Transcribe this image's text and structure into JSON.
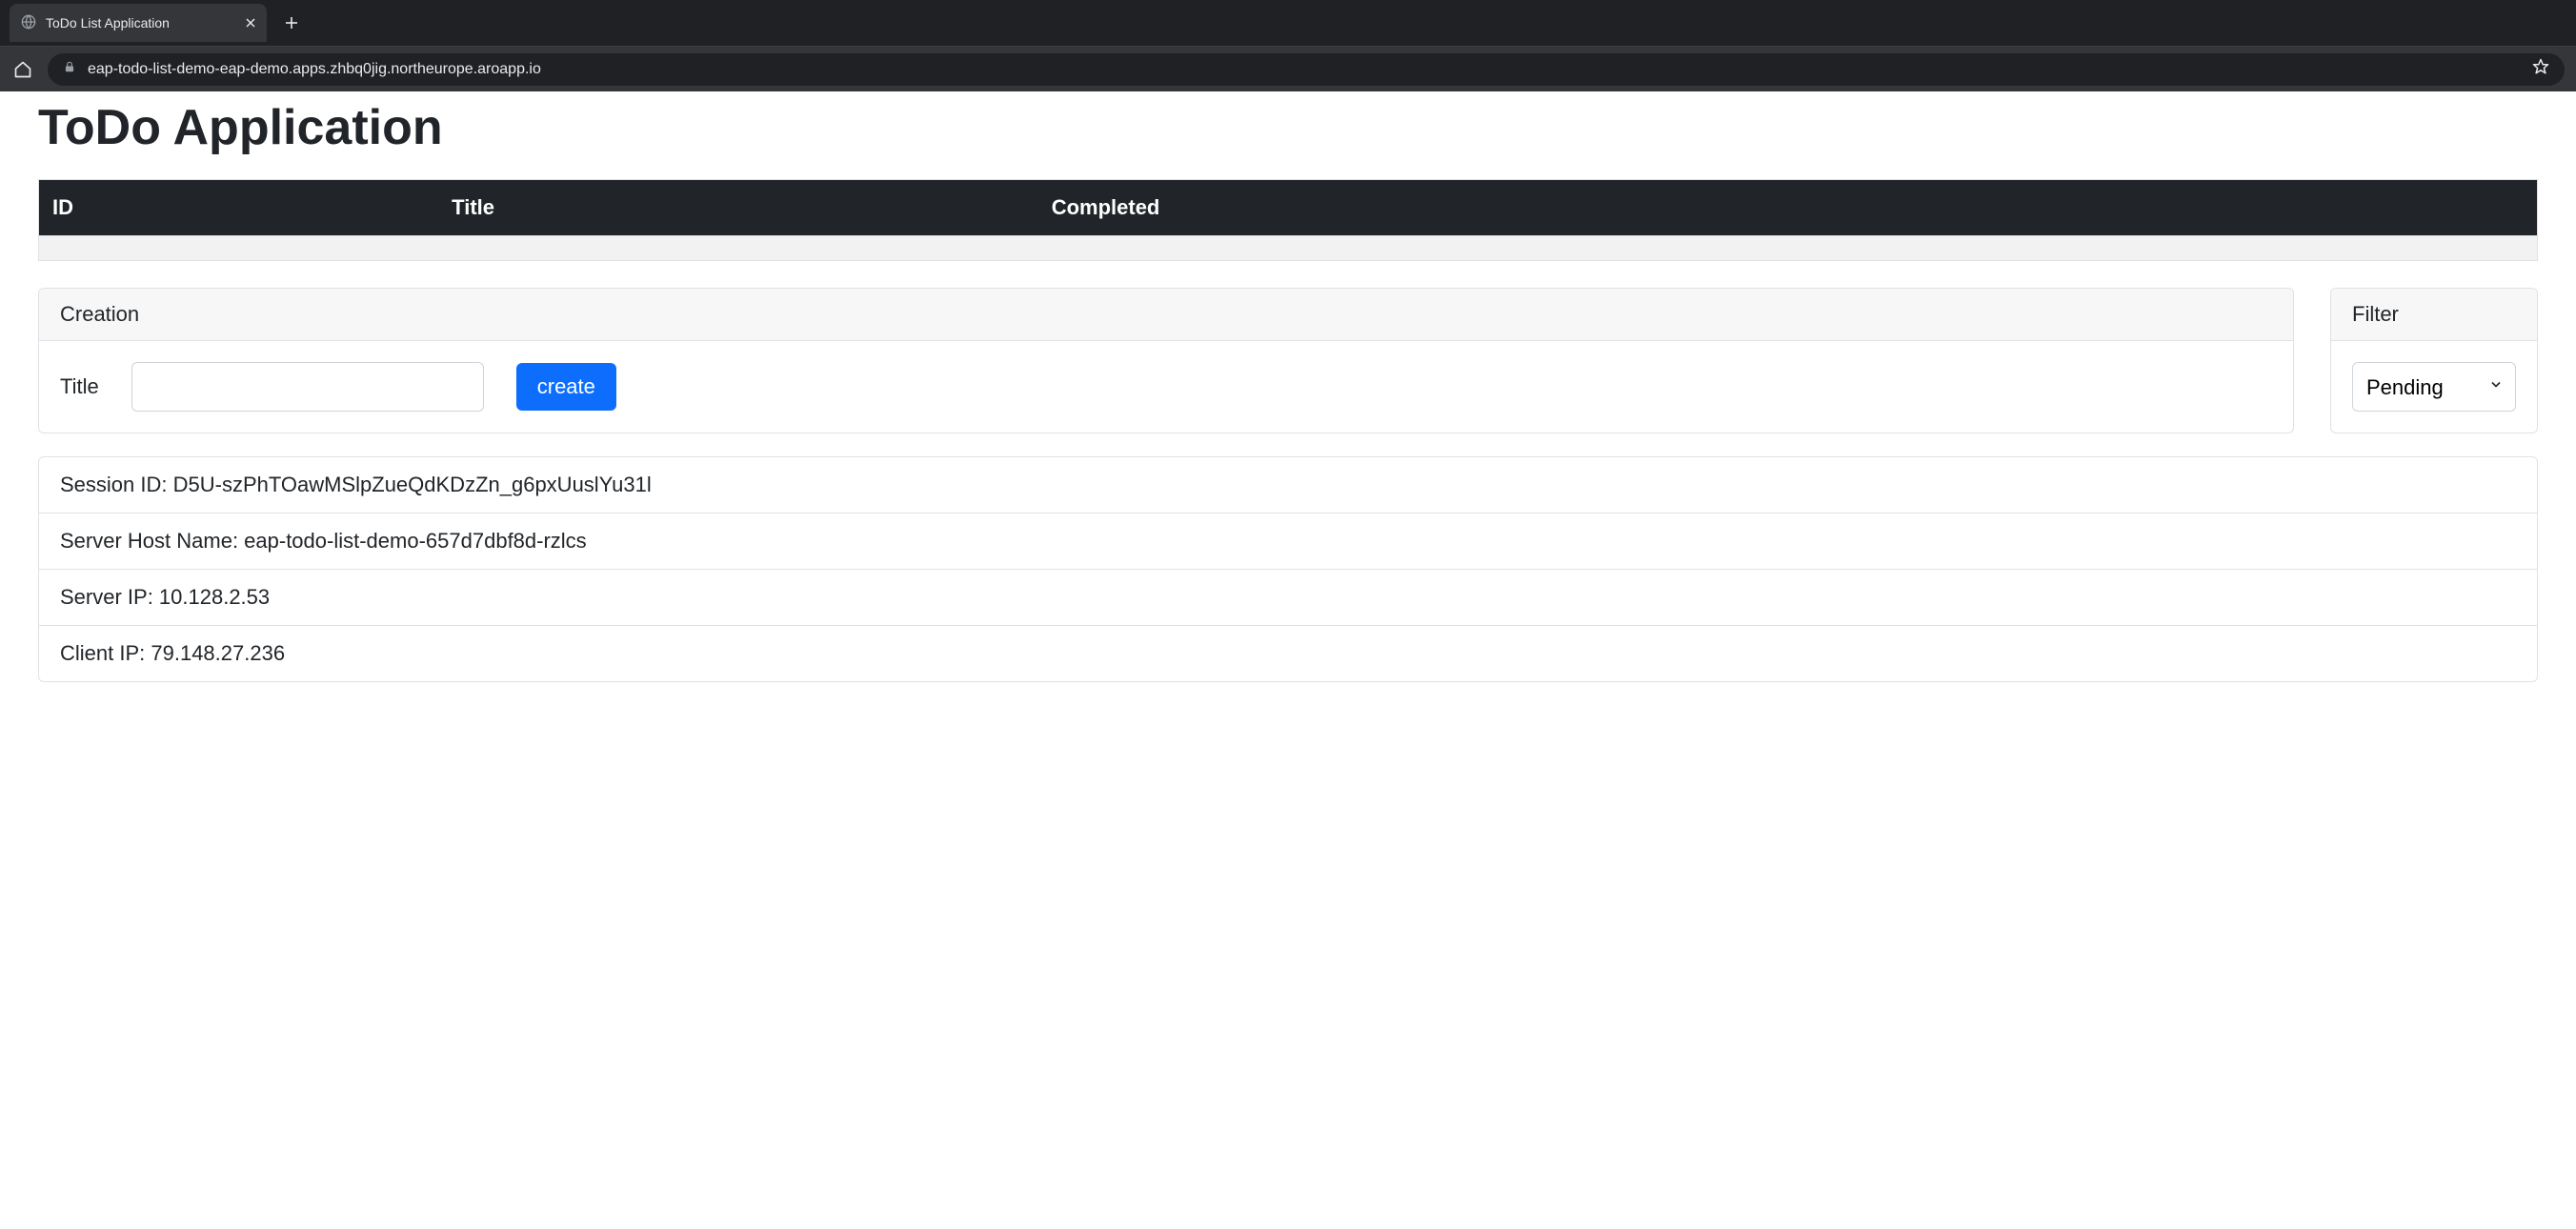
{
  "browser": {
    "tab_title": "ToDo List Application",
    "url": "eap-todo-list-demo-eap-demo.apps.zhbq0jig.northeurope.aroapp.io"
  },
  "page_title": "ToDo Application",
  "table": {
    "headers": {
      "id": "ID",
      "title": "Title",
      "completed": "Completed"
    }
  },
  "creation": {
    "card_title": "Creation",
    "title_label": "Title",
    "title_value": "",
    "create_button": "create"
  },
  "filter": {
    "card_title": "Filter",
    "selected": "Pending"
  },
  "info": {
    "session_id": "Session ID: D5U-szPhTOawMSlpZueQdKDzZn_g6pxUuslYu31l",
    "server_host": "Server Host Name: eap-todo-list-demo-657d7dbf8d-rzlcs",
    "server_ip": "Server IP: 10.128.2.53",
    "client_ip": "Client IP: 79.148.27.236"
  }
}
